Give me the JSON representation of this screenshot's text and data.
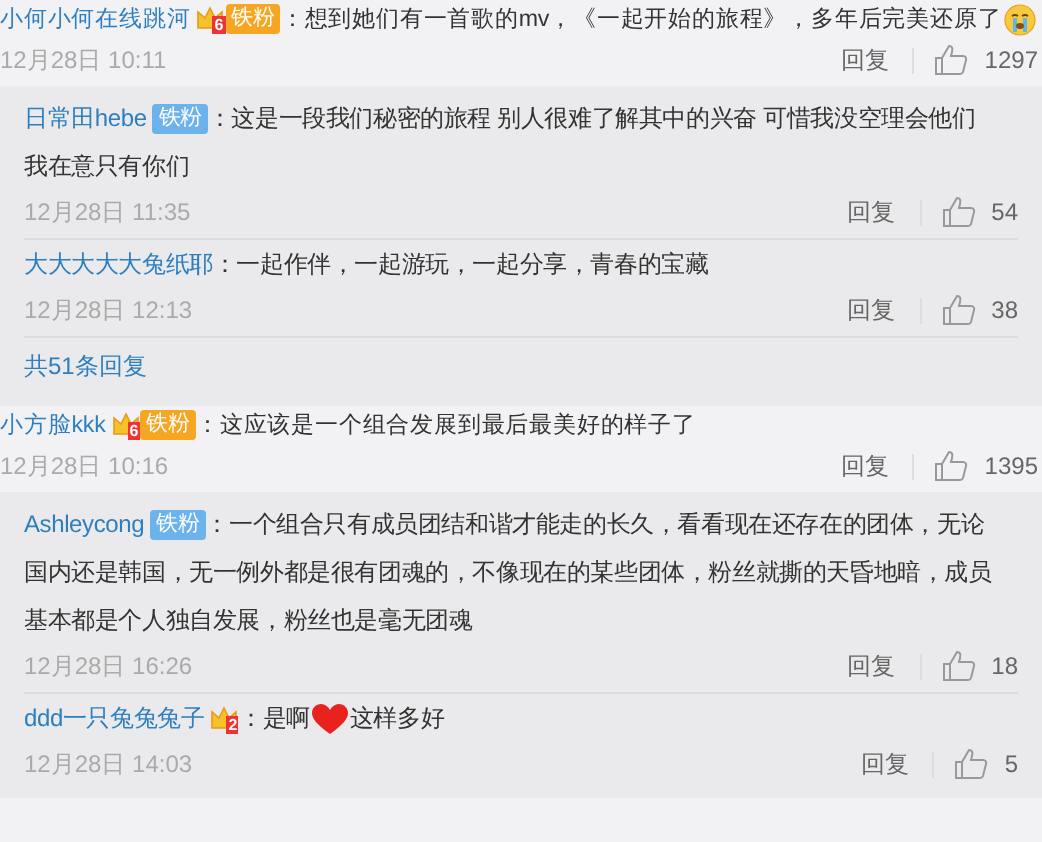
{
  "comments": [
    {
      "user": "小何小何在线跳河",
      "badge": {
        "kind": "crown",
        "level": "6",
        "label": "铁粉"
      },
      "content": [
        {
          "kind": "text",
          "text": "：想到她们有一首歌的mv，《一起开始的旅程》，多年后完美还原了"
        },
        {
          "kind": "crying"
        }
      ],
      "time": "12月28日 10:11",
      "reply_label": "回复",
      "likes": "1297",
      "replies": [
        {
          "user": "日常田hebe",
          "badge": {
            "kind": "fan",
            "label": "铁粉"
          },
          "content": [
            {
              "kind": "text",
              "text": "：这是一段我们秘密的旅程 别人很难了解其中的兴奋 可惜我没空理会他们"
            },
            {
              "kind": "line",
              "text": "我在意只有你们"
            }
          ],
          "time": "12月28日 11:35",
          "reply_label": "回复",
          "likes": "54"
        },
        {
          "user": "大大大大大兔纸耶",
          "content": [
            {
              "kind": "text",
              "text": "：一起作伴，一起游玩，一起分享，青春的宝藏"
            }
          ],
          "time": "12月28日 12:13",
          "reply_label": "回复",
          "likes": "38"
        }
      ],
      "more": "共51条回复"
    },
    {
      "user": "小方脸kkk",
      "badge": {
        "kind": "crown",
        "level": "6",
        "label": "铁粉"
      },
      "content": [
        {
          "kind": "text",
          "text": "：这应该是一个组合发展到最后最美好的样子了"
        }
      ],
      "time": "12月28日 10:16",
      "reply_label": "回复",
      "likes": "1395",
      "replies": [
        {
          "user": "Ashleycong",
          "badge": {
            "kind": "fan",
            "label": "铁粉"
          },
          "content": [
            {
              "kind": "text",
              "text": "：一个组合只有成员团结和谐才能走的长久，看看现在还存在的团体，无论"
            },
            {
              "kind": "line",
              "text": "国内还是韩国，无一例外都是很有团魂的，不像现在的某些团体，粉丝就撕的天昏地暗，成员"
            },
            {
              "kind": "line",
              "text": "基本都是个人独自发展，粉丝也是毫无团魂"
            }
          ],
          "time": "12月28日 16:26",
          "reply_label": "回复",
          "likes": "18"
        },
        {
          "user": "ddd一只兔兔兔子",
          "badge": {
            "kind": "crown",
            "level": "2"
          },
          "content": [
            {
              "kind": "text",
              "text": "：是啊"
            },
            {
              "kind": "heart"
            },
            {
              "kind": "text",
              "text": "这样多好"
            }
          ],
          "time": "12月28日 14:03",
          "reply_label": "回复",
          "likes": "5"
        }
      ]
    }
  ]
}
